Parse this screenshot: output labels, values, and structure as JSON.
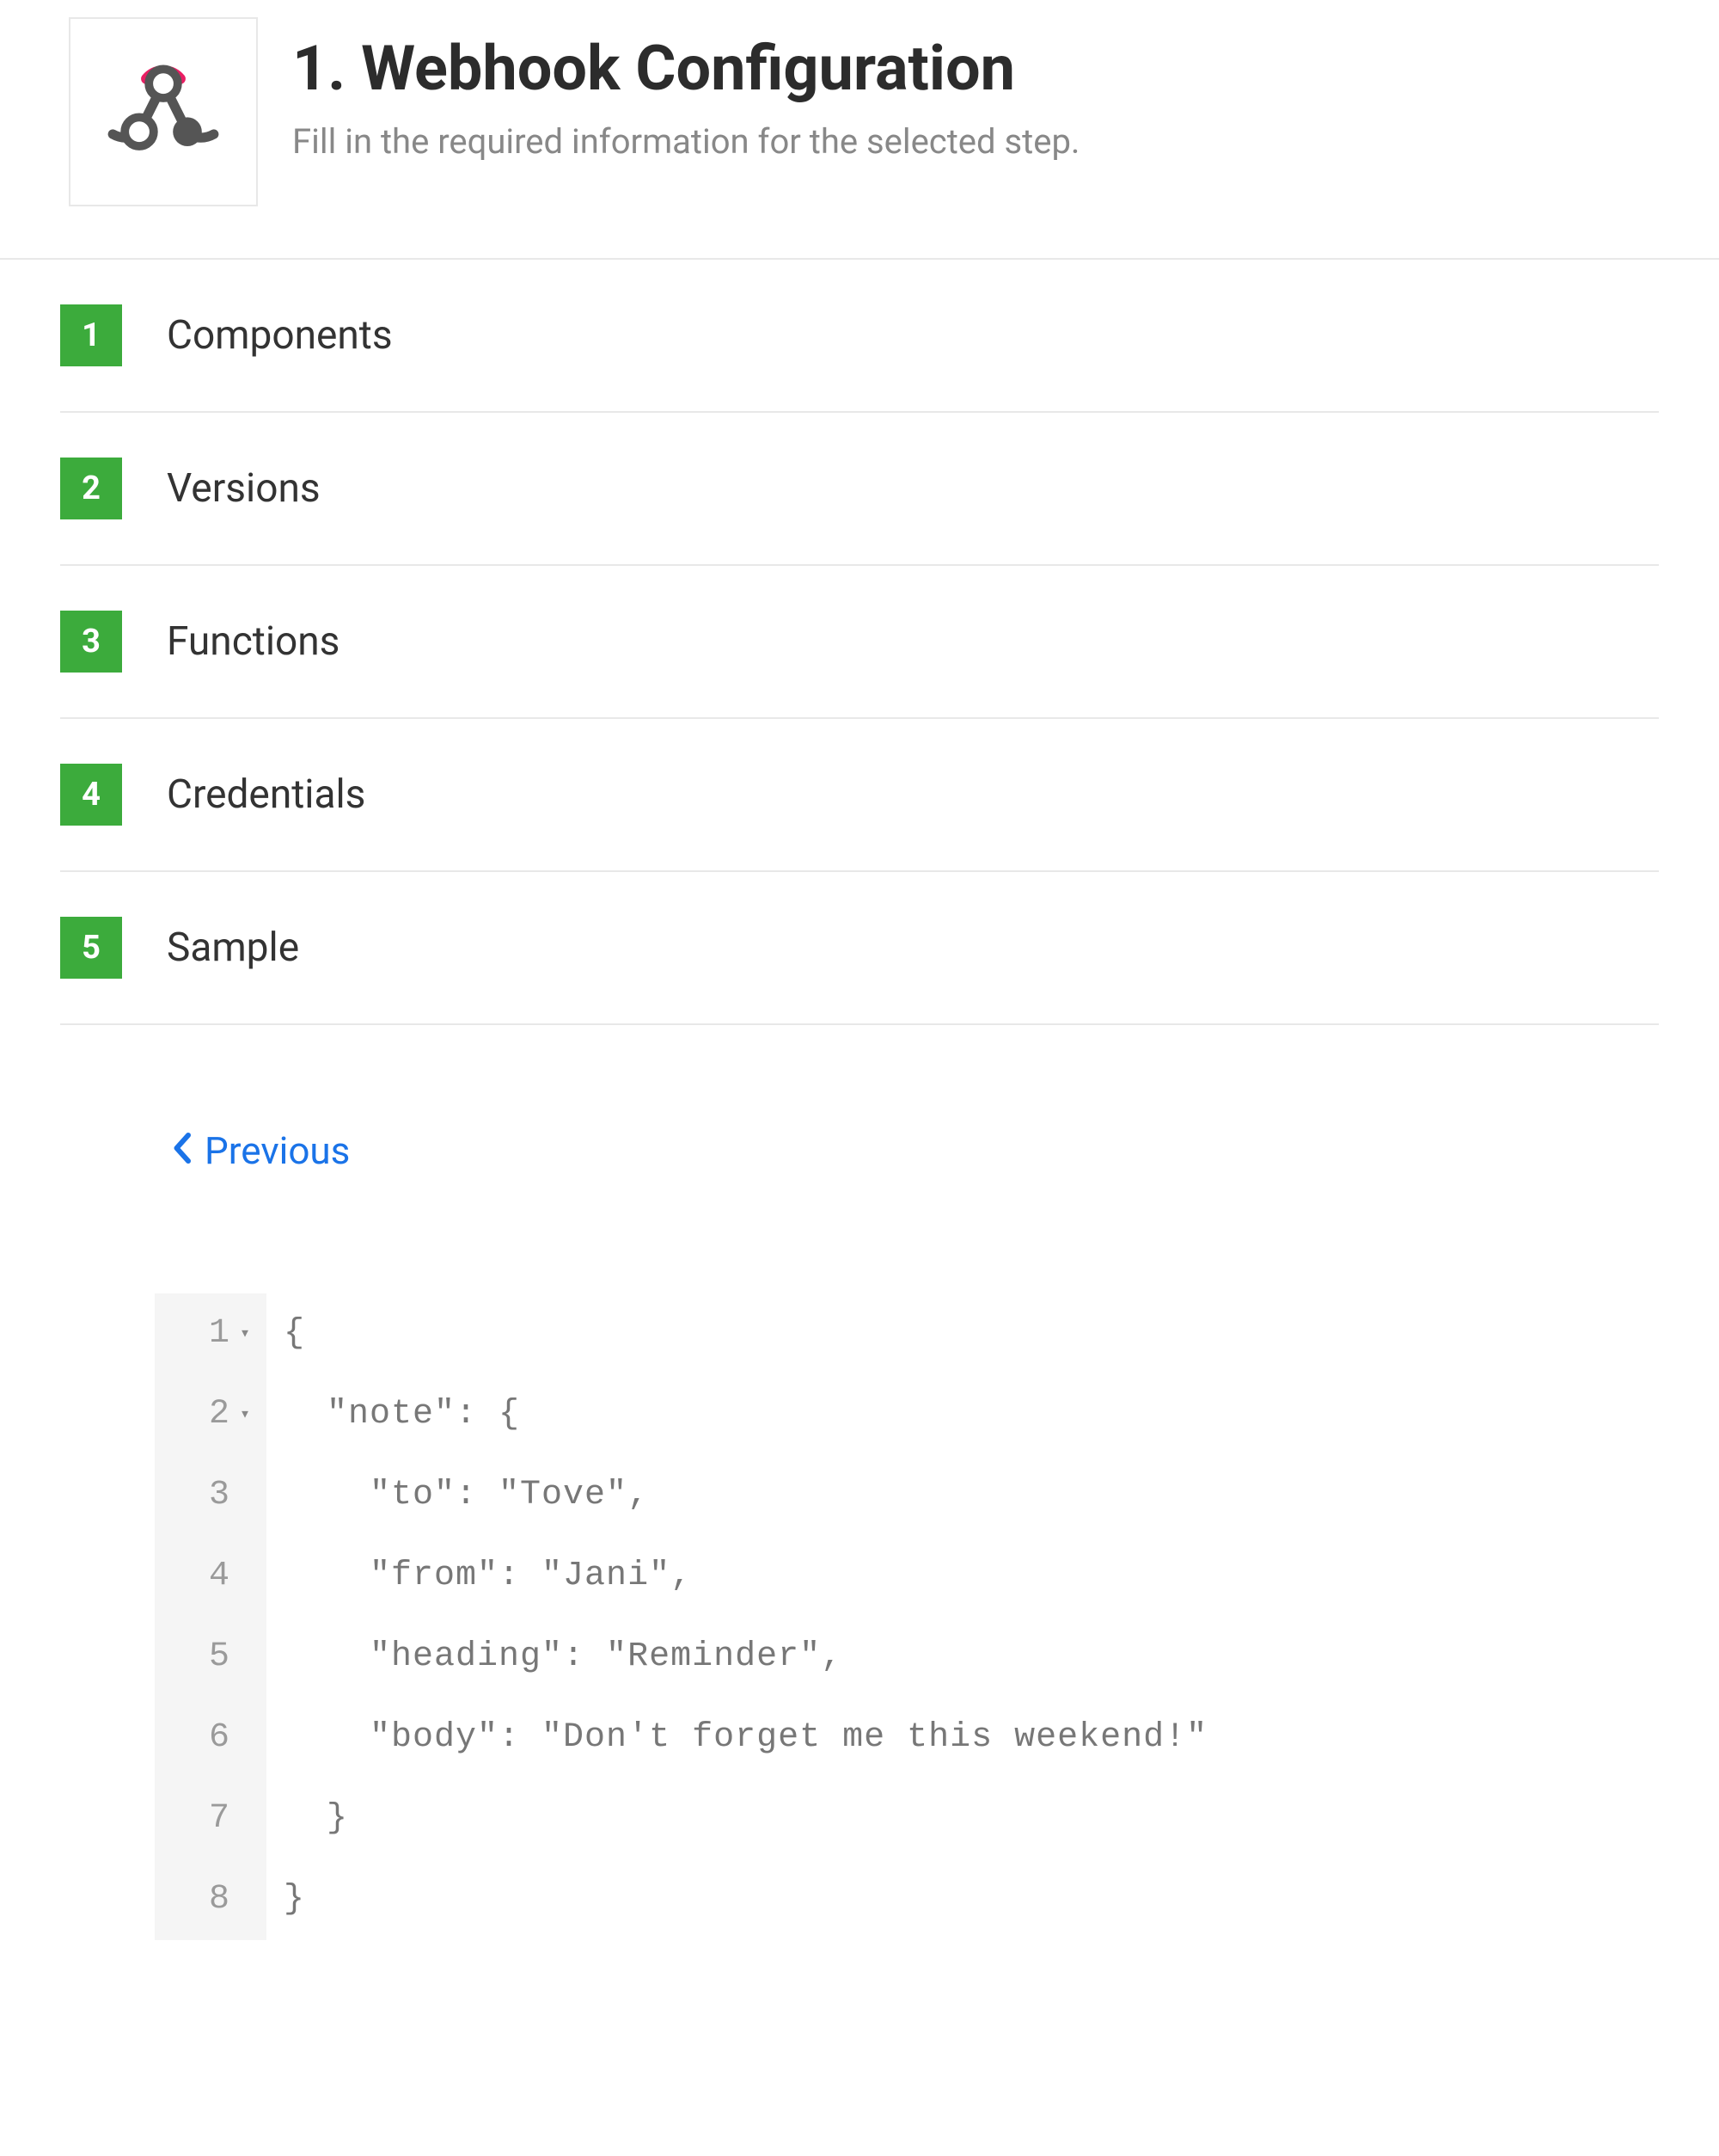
{
  "header": {
    "title": "1. Webhook Configuration",
    "subtitle": "Fill in the required information for the selected step.",
    "icon": "webhook-icon"
  },
  "steps": [
    {
      "number": "1",
      "label": "Components"
    },
    {
      "number": "2",
      "label": "Versions"
    },
    {
      "number": "3",
      "label": "Functions"
    },
    {
      "number": "4",
      "label": "Credentials"
    },
    {
      "number": "5",
      "label": "Sample"
    }
  ],
  "nav": {
    "previous_label": "Previous"
  },
  "colors": {
    "step_badge": "#3cab3c",
    "link": "#1a73e8",
    "icon_accent": "#e91e63",
    "icon_base": "#555555"
  },
  "code": {
    "lines": [
      {
        "num": "1",
        "foldable": true,
        "text": "{"
      },
      {
        "num": "2",
        "foldable": true,
        "text": "  \"note\": {"
      },
      {
        "num": "3",
        "foldable": false,
        "text": "    \"to\": \"Tove\","
      },
      {
        "num": "4",
        "foldable": false,
        "text": "    \"from\": \"Jani\","
      },
      {
        "num": "5",
        "foldable": false,
        "text": "    \"heading\": \"Reminder\","
      },
      {
        "num": "6",
        "foldable": false,
        "text": "    \"body\": \"Don't forget me this weekend!\""
      },
      {
        "num": "7",
        "foldable": false,
        "text": "  }"
      },
      {
        "num": "8",
        "foldable": false,
        "text": "}"
      }
    ]
  }
}
